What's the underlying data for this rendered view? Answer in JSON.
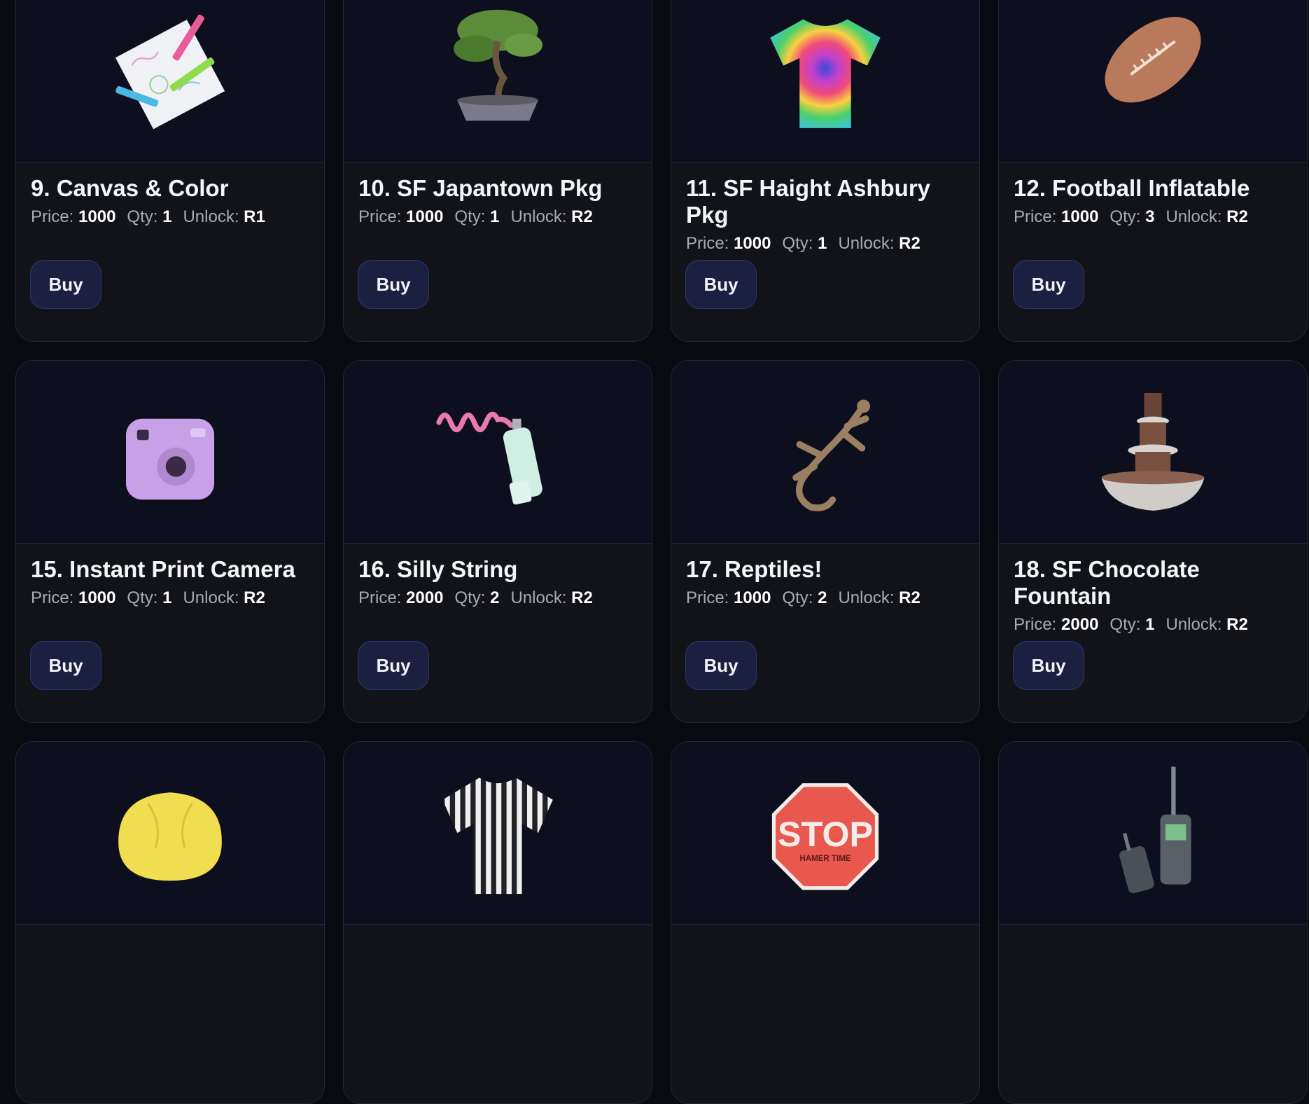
{
  "labels": {
    "price": "Price:",
    "qty": "Qty:",
    "unlock": "Unlock:",
    "buy": "Buy"
  },
  "items": [
    {
      "title": "9. Canvas & Color",
      "price": "1000",
      "qty": "1",
      "unlock": "R1",
      "icon": "canvas-color-icon"
    },
    {
      "title": "10. SF Japantown Pkg",
      "price": "1000",
      "qty": "1",
      "unlock": "R2",
      "icon": "bonsai-tree-icon"
    },
    {
      "title": "11. SF Haight Ashbury Pkg",
      "price": "1000",
      "qty": "1",
      "unlock": "R2",
      "icon": "tie-dye-shirt-icon"
    },
    {
      "title": "12. Football Inflatable",
      "price": "1000",
      "qty": "3",
      "unlock": "R2",
      "icon": "football-icon"
    },
    {
      "title": "15. Instant Print Camera",
      "price": "1000",
      "qty": "1",
      "unlock": "R2",
      "icon": "instant-camera-icon"
    },
    {
      "title": "16. Silly String",
      "price": "2000",
      "qty": "2",
      "unlock": "R2",
      "icon": "silly-string-icon"
    },
    {
      "title": "17. Reptiles!",
      "price": "1000",
      "qty": "2",
      "unlock": "R2",
      "icon": "lizard-icon"
    },
    {
      "title": "18. SF Chocolate Fountain",
      "price": "2000",
      "qty": "1",
      "unlock": "R2",
      "icon": "chocolate-fountain-icon"
    },
    {
      "icon": "bean-bag-icon"
    },
    {
      "icon": "striped-shirt-icon"
    },
    {
      "icon": "stop-sign-icon",
      "sign_text": "STOP",
      "sign_subtext": "HAMER TIME"
    },
    {
      "icon": "walkie-talkie-icon"
    }
  ]
}
